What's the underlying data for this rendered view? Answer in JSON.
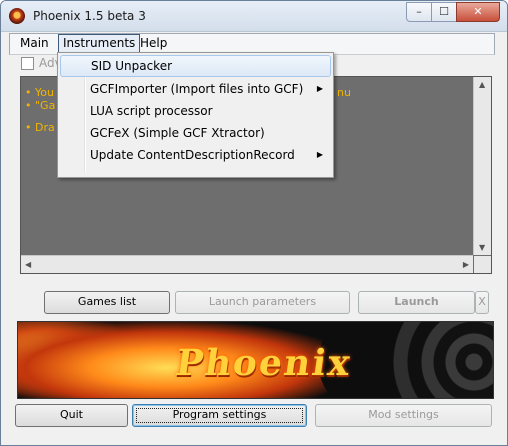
{
  "window": {
    "title": "Phoenix 1.5 beta 3",
    "minimize": "–",
    "maximize": "☐",
    "close": "✕"
  },
  "menubar": {
    "main": "Main",
    "instruments": "Instruments",
    "help": "Help"
  },
  "options": {
    "advanced_label": "Adv"
  },
  "log": {
    "lines": [
      "• You",
      "• \"Ga",
      "• Dra",
      "nu"
    ]
  },
  "instruments_menu": {
    "items": [
      {
        "label": "SID Unpacker",
        "submenu": false,
        "highlighted": true
      },
      {
        "label": "GCFImporter (Import files into GCF)",
        "submenu": true
      },
      {
        "label": "LUA script processor",
        "submenu": false
      },
      {
        "label": "GCFeX (Simple GCF Xtractor)",
        "submenu": false
      },
      {
        "label": "Update ContentDescriptionRecord",
        "submenu": true
      }
    ],
    "submenu_arrow": "▶"
  },
  "buttons": {
    "games_list": "Games list",
    "launch_parameters": "Launch parameters",
    "launch": "Launch",
    "launch_x": "X",
    "quit": "Quit",
    "program_settings": "Program settings",
    "mod_settings": "Mod settings"
  },
  "banner": {
    "logo_text": "Phoenix"
  },
  "scroll": {
    "up": "▲",
    "down": "▼",
    "left": "◀",
    "right": "▶"
  }
}
